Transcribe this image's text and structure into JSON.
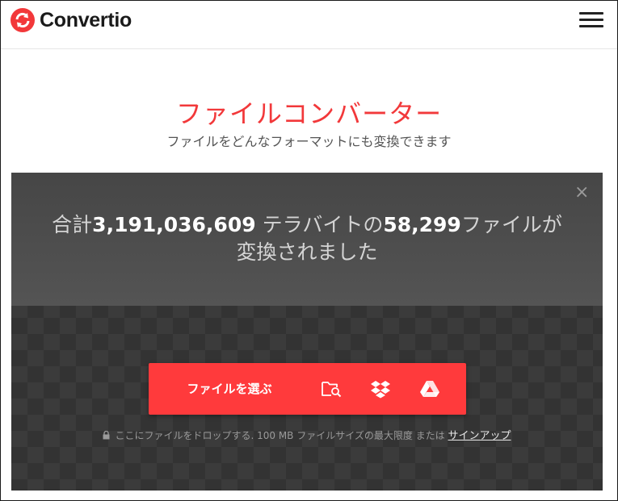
{
  "header": {
    "logo_text": "Convertio",
    "menu_icon": "hamburger-menu-icon"
  },
  "main": {
    "title": "ファイルコンバーター",
    "subtitle": "ファイルをどんなフォーマットにも変換できます"
  },
  "stats": {
    "prefix": "合計",
    "terabytes": "3,191,036,609",
    "terabytes_unit": " テラバイトの",
    "files": "58,299",
    "files_suffix": "ファイルが",
    "line2": "変換されました",
    "close_label": "×"
  },
  "upload": {
    "choose_label": "ファイルを選ぶ",
    "sources": [
      "folder-search-icon",
      "dropbox-icon",
      "google-drive-icon"
    ]
  },
  "note": {
    "text": "ここにファイルをドロップする. 100 MB ファイルサイズの最大限度 または ",
    "signup_link": "サインアップ"
  },
  "colors": {
    "accent": "#ff3a3c",
    "title": "#f2383a",
    "panel": "#3b3b3b"
  }
}
